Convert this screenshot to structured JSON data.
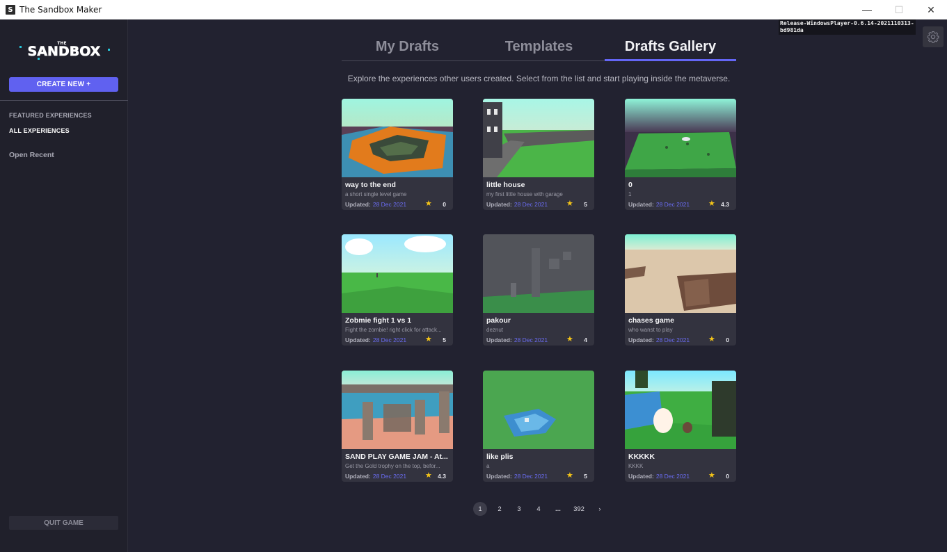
{
  "window": {
    "title": "The Sandbox Maker",
    "app_icon": "S",
    "minimize": "—",
    "maximize": "☐",
    "close": "✕"
  },
  "sidebar": {
    "logo_small": "THE",
    "logo_main": "SANDBOX",
    "create_label": "CREATE NEW +",
    "featured_label": "FEATURED EXPERIENCES",
    "all_label": "ALL EXPERIENCES",
    "recent_label": "Open Recent",
    "quit_label": "QUIT GAME"
  },
  "version": {
    "line1": "Release-WindowsPlayer-0.6.14-2021110313-",
    "line2": "bd981da"
  },
  "tabs": [
    {
      "label": "My Drafts",
      "active": false
    },
    {
      "label": "Templates",
      "active": false
    },
    {
      "label": "Drafts Gallery",
      "active": true
    }
  ],
  "subtitle": "Explore the experiences other users created. Select from the list and start playing inside the metaverse.",
  "updated_label": "Updated:",
  "cards": [
    {
      "title": "way to the end",
      "desc": "a short single level game",
      "date": "28 Dec 2021",
      "rating": "0"
    },
    {
      "title": "little house",
      "desc": "my first  little house with garage",
      "date": "28 Dec 2021",
      "rating": "5"
    },
    {
      "title": "0",
      "desc": "1",
      "date": "28 Dec 2021",
      "rating": "4.3"
    },
    {
      "title": "Zobmie fight 1 vs 1",
      "desc": "Fight the zombie! right click for attack...",
      "date": "28 Dec 2021",
      "rating": "5"
    },
    {
      "title": "pakour",
      "desc": "deznut",
      "date": "28 Dec 2021",
      "rating": "4"
    },
    {
      "title": "chases game",
      "desc": "who wanst to play",
      "date": "28 Dec 2021",
      "rating": "0"
    },
    {
      "title": "SAND PLAY GAME JAM - At...",
      "desc": "Get the Gold trophy on the top, befor...",
      "date": "28 Dec 2021",
      "rating": "4.3"
    },
    {
      "title": "like plis",
      "desc": "a",
      "date": "28 Dec 2021",
      "rating": "5"
    },
    {
      "title": "KKKKK",
      "desc": "KKKK",
      "date": "28 Dec 2021",
      "rating": "0"
    }
  ],
  "pagination": {
    "pages": [
      "1",
      "2",
      "3",
      "4"
    ],
    "ellipsis": "...",
    "last": "392",
    "next": "›",
    "current": "1"
  },
  "icons": {
    "star": "star-icon",
    "settings": "gear-icon",
    "next": "chevron-right-icon"
  },
  "colors": {
    "accent": "#6466f5",
    "background": "#222230",
    "sidebar": "#20202b",
    "card": "#33333f",
    "star": "#f5c518",
    "date": "#6a6cf2"
  }
}
